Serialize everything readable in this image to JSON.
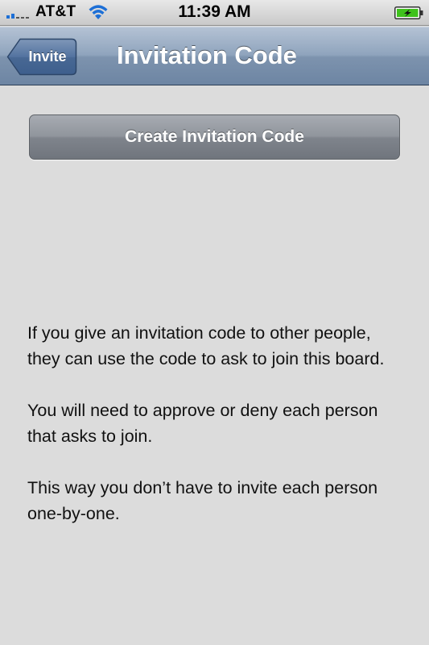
{
  "status_bar": {
    "carrier": "AT&T",
    "time": "11:39 AM",
    "icons": [
      "signal-bars-icon",
      "wifi-icon",
      "battery-charging-icon"
    ]
  },
  "nav_bar": {
    "back_label": "Invite",
    "title": "Invitation Code"
  },
  "main": {
    "create_button_label": "Create Invitation Code",
    "paragraphs": [
      "If you give an invitation code to other people, they can use the code to ask to join this board.",
      "You will need to approve or deny each person that asks to join.",
      "This way you don’t have to invite each person one-by-one."
    ]
  },
  "colors": {
    "nav_bar": "#8fa4bd",
    "background": "#dcdcdc",
    "button": "#858a92",
    "battery_fill": "#3fc21c"
  }
}
